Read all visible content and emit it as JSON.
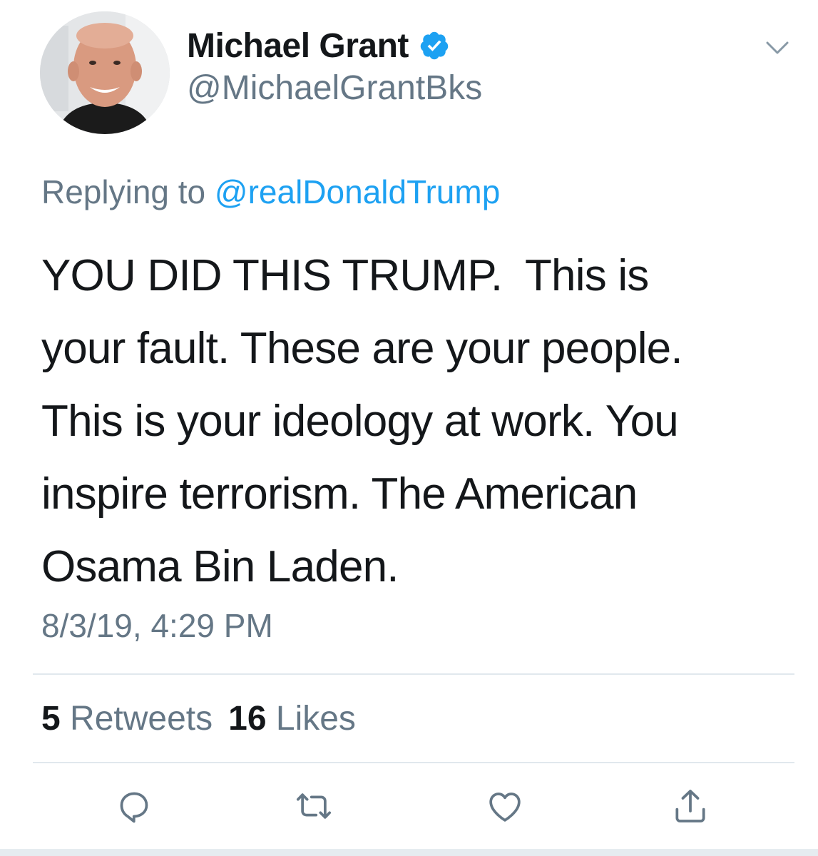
{
  "author": {
    "display_name": "Michael Grant",
    "handle": "@MichaelGrantBks",
    "verified": true,
    "avatar_icon": "profile-photo"
  },
  "menu": {
    "icon": "chevron-down-icon"
  },
  "reply": {
    "prefix": "Replying to ",
    "mention": "@realDonaldTrump"
  },
  "tweet": {
    "lines": [
      "YOU DID THIS TRUMP.  This is",
      "your fault. These are your people.",
      "This is your ideology at work. You",
      "inspire terrorism. The American",
      "Osama Bin Laden."
    ]
  },
  "timestamp": "8/3/19, 4:29 PM",
  "stats": {
    "retweets_count": "5",
    "retweets_label": "Retweets",
    "likes_count": "16",
    "likes_label": "Likes"
  },
  "actions": [
    "reply-icon",
    "retweet-icon",
    "like-icon",
    "share-icon"
  ],
  "colors": {
    "text": "#14171a",
    "secondary": "#657786",
    "link": "#1da1f2",
    "divider": "#e1e8ed"
  }
}
